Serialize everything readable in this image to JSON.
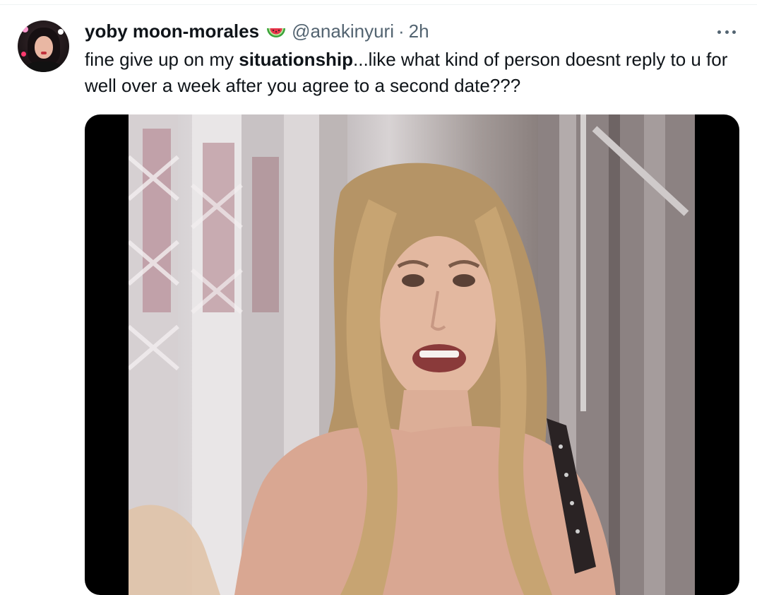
{
  "tweet": {
    "display_name": "yoby moon-morales",
    "name_emoji": "watermelon-emoji",
    "handle": "@anakinyuri",
    "separator": "·",
    "time": "2h",
    "text_before": "fine give up on my ",
    "text_bold": "situationship",
    "text_after": "...like what kind of person doesnt reply to u for well over a week after you agree to a second date???",
    "more_icon": "ellipsis-icon"
  },
  "colors": {
    "primary_text": "#0f1419",
    "secondary_text": "#536471",
    "media_letterbox": "#000000"
  }
}
